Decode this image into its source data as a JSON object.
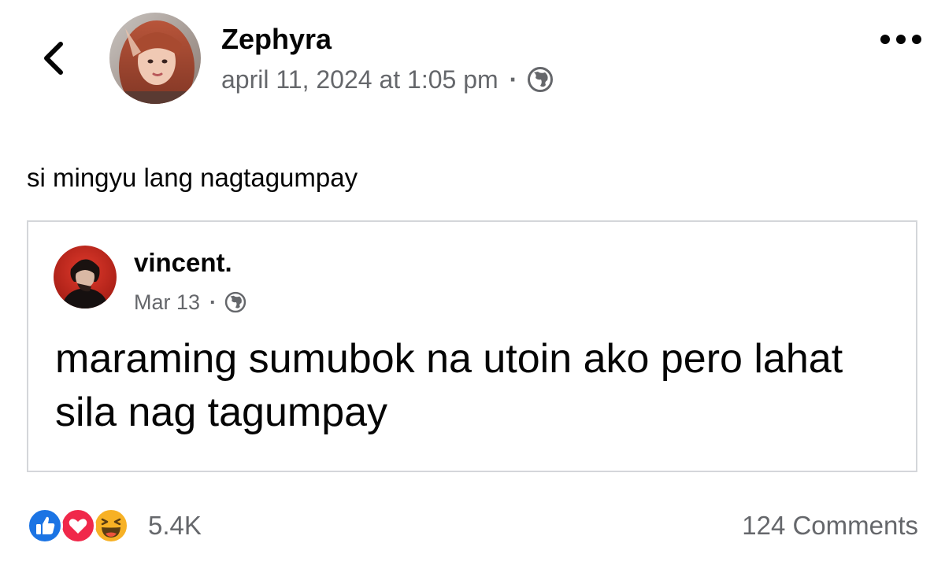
{
  "post": {
    "author": "Zephyra",
    "timestamp": "april 11, 2024 at 1:05 pm",
    "separator": "·",
    "privacy_icon": "globe-icon",
    "text": "si mingyu lang nagtagumpay"
  },
  "shared_post": {
    "author": "vincent.",
    "timestamp": "Mar 13",
    "separator": "·",
    "privacy_icon": "globe-icon",
    "text": "maraming sumubok na utoin ako pero lahat sila nag tagumpay"
  },
  "footer": {
    "reactions": [
      "like-icon",
      "love-icon",
      "haha-icon"
    ],
    "reaction_count": "5.4K",
    "comments": "124 Comments"
  },
  "colors": {
    "text_primary": "#050505",
    "text_secondary": "#65676b",
    "like_blue": "#1b74e4",
    "love_red": "#f0284a",
    "haha_yellow": "#f7b125",
    "card_border": "#d4d6da"
  }
}
